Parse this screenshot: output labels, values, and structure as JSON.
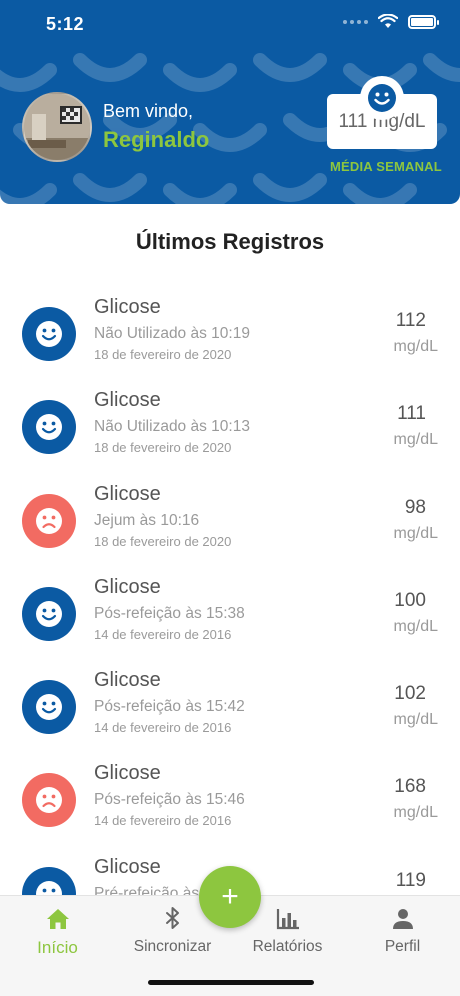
{
  "status_bar": {
    "time": "5:12"
  },
  "header": {
    "welcome": "Bem vindo,",
    "username": "Reginaldo",
    "weekly_average": {
      "value": "111 mg/dL",
      "label": "MÉDIA SEMANAL",
      "icon": "smiley-face-icon"
    }
  },
  "section_title": "Últimos Registros",
  "records": [
    {
      "title": "Glicose",
      "subtitle": "Não Utilizado às 10:19",
      "date": "18 de fevereiro de 2020",
      "value": "112",
      "unit": "mg/dL",
      "mood": "happy"
    },
    {
      "title": "Glicose",
      "subtitle": "Não Utilizado às 10:13",
      "date": "18 de fevereiro de 2020",
      "value": "111",
      "unit": "mg/dL",
      "mood": "happy"
    },
    {
      "title": "Glicose",
      "subtitle": "Jejum às 10:16",
      "date": "18 de fevereiro de 2020",
      "value": "98",
      "unit": "mg/dL",
      "mood": "sad"
    },
    {
      "title": "Glicose",
      "subtitle": "Pós-refeição às 15:38",
      "date": "14 de fevereiro de 2016",
      "value": "100",
      "unit": "mg/dL",
      "mood": "happy"
    },
    {
      "title": "Glicose",
      "subtitle": "Pós-refeição às 15:42",
      "date": "14 de fevereiro de 2016",
      "value": "102",
      "unit": "mg/dL",
      "mood": "happy"
    },
    {
      "title": "Glicose",
      "subtitle": "Pós-refeição às 15:46",
      "date": "14 de fevereiro de 2016",
      "value": "168",
      "unit": "mg/dL",
      "mood": "sad"
    },
    {
      "title": "Glicose",
      "subtitle": "Pré-refeição às",
      "date": "",
      "value": "119",
      "unit": "",
      "mood": "happy"
    }
  ],
  "tabs": [
    {
      "label": "Início",
      "icon": "home-icon",
      "active": true
    },
    {
      "label": "Sincronizar",
      "icon": "bluetooth-icon",
      "active": false
    },
    {
      "label": "Relatórios",
      "icon": "bar-chart-icon",
      "active": false
    },
    {
      "label": "Perfil",
      "icon": "person-icon",
      "active": false
    }
  ],
  "fab": {
    "label": "+"
  },
  "colors": {
    "primary": "#0b5aa3",
    "accent": "#8dc63f",
    "alert": "#f26b62"
  }
}
